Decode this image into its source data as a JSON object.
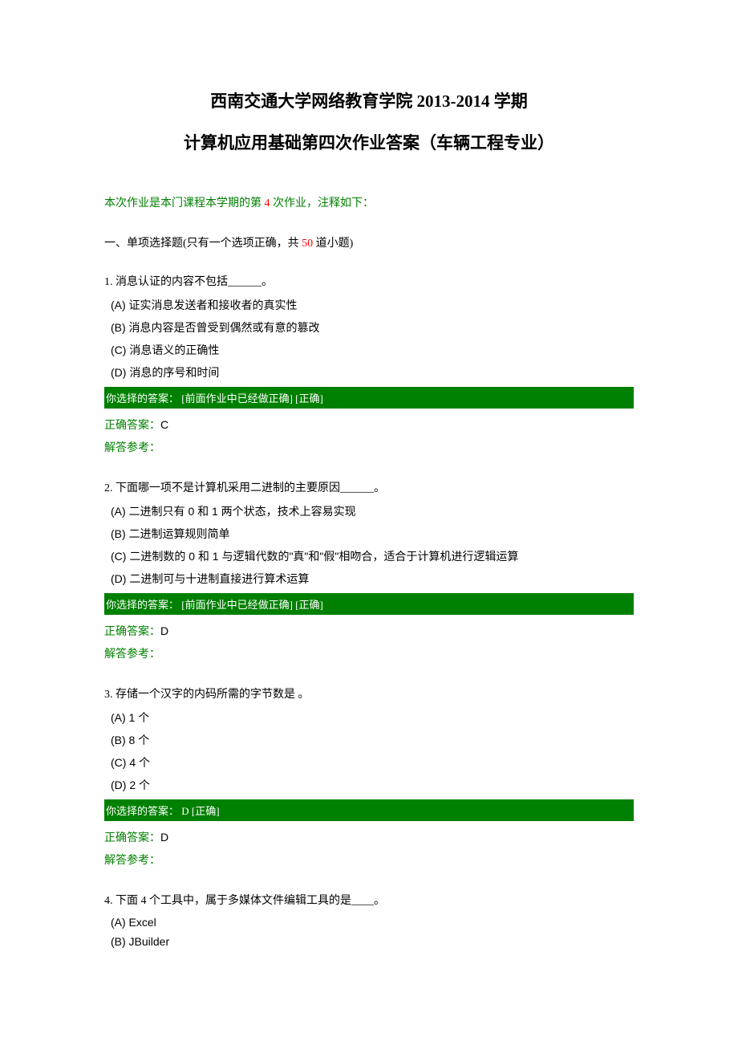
{
  "title": {
    "line1": "西南交通大学网络教育学院 2013-2014 学期",
    "line2": "计算机应用基础第四次作业答案（车辆工程专业）"
  },
  "intro": {
    "prefix": "本次作业是本门课程本学期的第 ",
    "num": "4",
    "suffix": " 次作业，注释如下："
  },
  "section": {
    "prefix": "一、单项选择题(只有一个选项正确，共 ",
    "num": "50",
    "suffix": " 道小题)"
  },
  "labels": {
    "your_answer_prefix": "你选择的答案： ",
    "prev_correct": "[前面作业中已经做正确]  [正确]",
    "correct_tag": "[正确]",
    "correct_answer_label": "正确答案：",
    "solution_ref": "解答参考："
  },
  "questions": [
    {
      "num": "1.",
      "text": " 消息认证的内容不包括______。",
      "options": [
        "(A) 证实消息发送者和接收者的真实性",
        "(B) 消息内容是否曾受到偶然或有意的篡改",
        "(C) 消息语义的正确性",
        "(D) 消息的序号和时间"
      ],
      "your_answer_text": "[前面作业中已经做正确]  [正确]",
      "correct": "C"
    },
    {
      "num": "2.",
      "text": " 下面哪一项不是计算机采用二进制的主要原因______。",
      "options": [
        "(A) 二进制只有 0 和 1 两个状态，技术上容易实现",
        "(B) 二进制运算规则简单",
        "(C) 二进制数的 0 和 1 与逻辑代数的\"真\"和\"假\"相吻合，适合于计算机进行逻辑运算",
        "(D) 二进制可与十进制直接进行算术运算"
      ],
      "your_answer_text": " [前面作业中已经做正确]  [正确]",
      "correct": "D"
    },
    {
      "num": "3.",
      "text": " 存储一个汉字的内码所需的字节数是 。",
      "options": [
        "(A) 1 个",
        "(B) 8 个",
        "(C) 4 个",
        "(D) 2 个"
      ],
      "your_answer_text": " D  [正确]",
      "correct": "D"
    },
    {
      "num": "4.",
      "text": " 下面 4 个工具中，属于多媒体文件编辑工具的是____。",
      "options": [
        "(A) Excel",
        "(B) JBuilder"
      ],
      "your_answer_text": null,
      "correct": null
    }
  ]
}
